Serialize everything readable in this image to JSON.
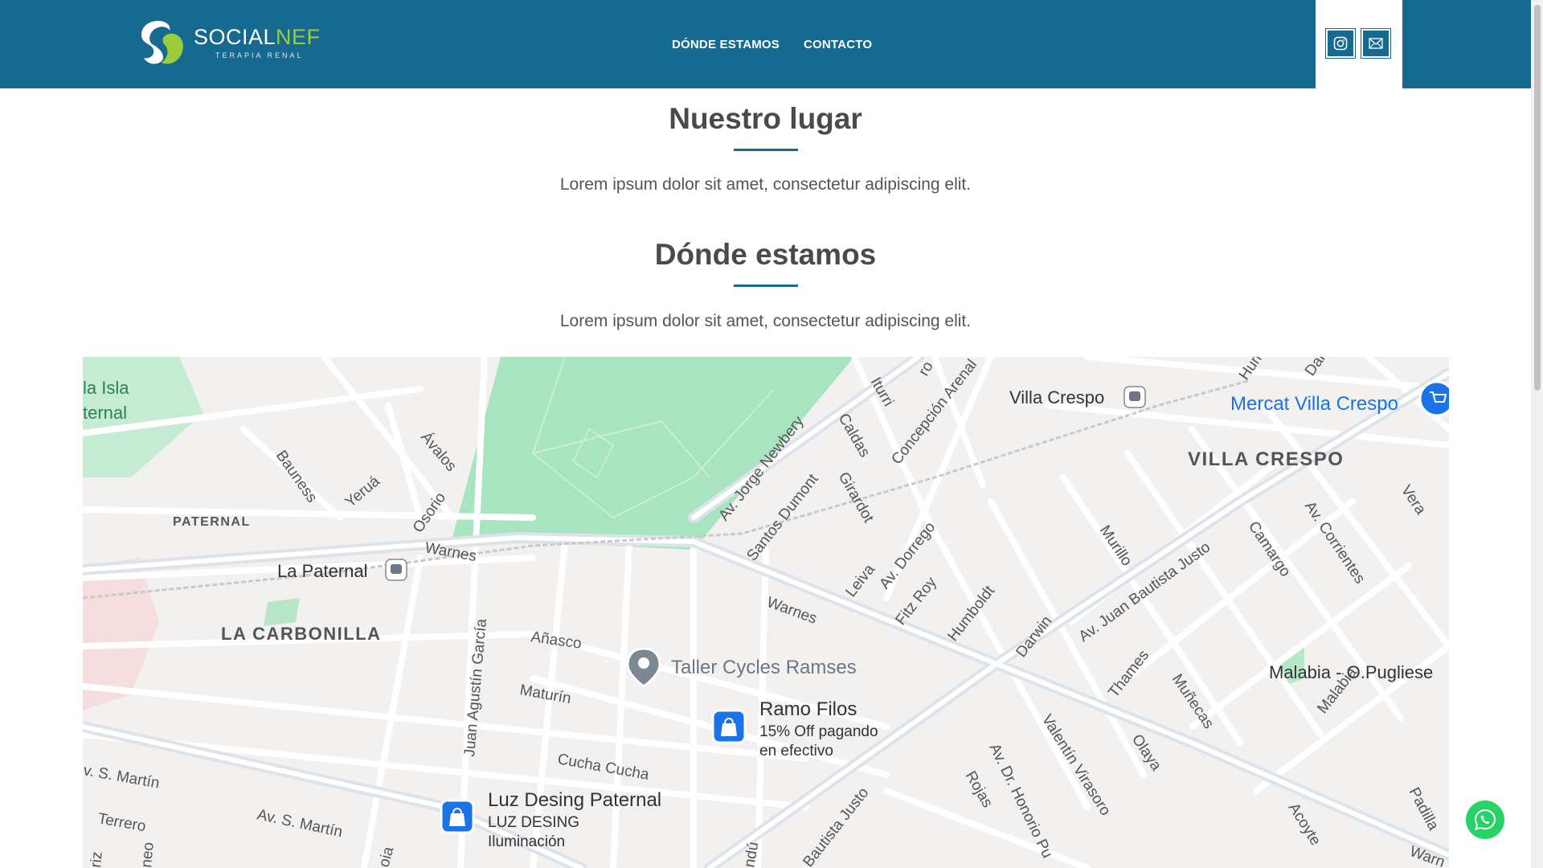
{
  "brand": {
    "name_part1": "SOCIAL",
    "name_part2": "NEF",
    "tagline": "TERAPIA RENAL"
  },
  "nav": [
    {
      "label": "DÓNDE ESTAMOS"
    },
    {
      "label": "CONTACTO"
    }
  ],
  "social": {
    "instagram_icon": "instagram-icon",
    "mail_icon": "mail-icon"
  },
  "sections": [
    {
      "title": "Nuestro lugar",
      "text": "Lorem ipsum dolor sit amet, consectetur adipiscing elit."
    },
    {
      "title": "Dónde estamos",
      "text": "Lorem ipsum dolor sit amet, consectetur adipiscing elit."
    }
  ],
  "map": {
    "neighborhoods": [
      "VILLA CRESPO",
      "PATERNAL",
      "LA CARBONILLA"
    ],
    "stations": [
      "Villa Crespo",
      "La Paternal"
    ],
    "places": [
      {
        "name": "Mercat Villa Crespo"
      },
      {
        "name": "Taller Cycles Ramses"
      },
      {
        "name": "Ramo Filos",
        "line1": "15% Off pagando",
        "line2": "en efectivo"
      },
      {
        "name": "Luz Desing Paternal",
        "line1": "LUZ DESING",
        "line2": "Iluminación"
      },
      {
        "name": "Malabia - O.Pugliese"
      }
    ],
    "edge_labels": [
      "la Isla",
      "ternal"
    ],
    "streets": [
      "Av. Jorge Newbery",
      "Iturri",
      "Concepción Arenal",
      "Caldas",
      "Girardot",
      "Santos Dumont",
      "Av. Dorrego",
      "Leiva",
      "Fitz Roy",
      "Humboldt",
      "Darwin",
      "Warnes",
      "Av. Juan Bautista Justo",
      "Murillo",
      "Camargo",
      "Av. Corrientes",
      "Vera",
      "Thames",
      "Muñecas",
      "Malabia",
      "Olaya",
      "Valentín Virasoro",
      "Av. Dr. Honorio Pu",
      "Rojas",
      "Acoyte",
      "Padilla",
      "Juan Agustín García",
      "Añasco",
      "Maturín",
      "Cucha Cucha",
      "Av. S. Martín",
      "Terrero",
      "Bauness",
      "Yeruá",
      "Ávalos",
      "Osorio",
      "Warnes",
      "Hum",
      "Dar",
      "ro",
      "Bautista Justo",
      "ndú",
      "Warn",
      "neo",
      "riz",
      "v. S. Martín",
      "oia"
    ]
  },
  "colors": {
    "header": "#176a8f",
    "accent_green": "#9ccc3c",
    "whatsapp": "#25d366"
  }
}
